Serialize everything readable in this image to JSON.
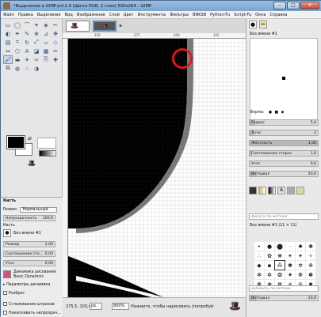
{
  "window": {
    "title": "*Выделение в GIMP.xcf-1.0 (Цвета RGB, 2 слоя) 500x284 – GIMP",
    "controls": {
      "minimize": "–",
      "maximize": "□",
      "close": "✕"
    }
  },
  "menubar": {
    "items": [
      "Файл",
      "Правка",
      "Выделение",
      "Вид",
      "Изображение",
      "Слой",
      "Цвет",
      "Инструменты",
      "Фильтры",
      "BNKSB",
      "Python-Fu",
      "Script-Fu",
      "Окна",
      "Справка"
    ]
  },
  "toolbox": {
    "tools": [
      {
        "icon": "rect-select-icon",
        "glyph": "▭"
      },
      {
        "icon": "ellipse-select-icon",
        "glyph": "◯"
      },
      {
        "icon": "free-select-icon",
        "glyph": "⌒"
      },
      {
        "icon": "fuzzy-select-icon",
        "glyph": "✦"
      },
      {
        "icon": "color-select-icon",
        "glyph": "◈"
      },
      {
        "icon": "scissors-icon",
        "glyph": "✂"
      },
      {
        "icon": "foreground-select-icon",
        "glyph": "◐"
      },
      {
        "icon": "paths-icon",
        "glyph": "✒"
      },
      {
        "icon": "color-picker-icon",
        "glyph": "✎"
      },
      {
        "icon": "zoom-icon",
        "glyph": "⊕"
      },
      {
        "icon": "measure-icon",
        "glyph": "⊿"
      },
      {
        "icon": "move-icon",
        "glyph": "✥"
      },
      {
        "icon": "align-icon",
        "glyph": "▤"
      },
      {
        "icon": "crop-icon",
        "glyph": "⌗"
      },
      {
        "icon": "rotate-icon",
        "glyph": "↻"
      },
      {
        "icon": "scale-icon",
        "glyph": "⤢"
      },
      {
        "icon": "shear-icon",
        "glyph": "▱"
      },
      {
        "icon": "perspective-icon",
        "glyph": "◇"
      },
      {
        "icon": "flip-icon",
        "glyph": "⇔"
      },
      {
        "icon": "cage-icon",
        "glyph": "⬡"
      },
      {
        "icon": "text-icon",
        "glyph": "A"
      },
      {
        "icon": "bucket-fill-icon",
        "glyph": "◪"
      },
      {
        "icon": "blend-icon",
        "glyph": "▦"
      },
      {
        "icon": "pencil-icon",
        "glyph": "✏"
      },
      {
        "icon": "paintbrush-icon",
        "glyph": "🖌"
      },
      {
        "icon": "eraser-icon",
        "glyph": "▬"
      },
      {
        "icon": "airbrush-icon",
        "glyph": "✈"
      },
      {
        "icon": "ink-icon",
        "glyph": "✑"
      },
      {
        "icon": "clone-icon",
        "glyph": "⎘"
      },
      {
        "icon": "heal-icon",
        "glyph": "✚"
      },
      {
        "icon": "perspective-clone-icon",
        "glyph": "⧉"
      },
      {
        "icon": "blur-icon",
        "glyph": "◍"
      },
      {
        "icon": "smudge-icon",
        "glyph": "☝"
      },
      {
        "icon": "dodge-burn-icon",
        "glyph": "◑"
      }
    ],
    "active_tool": 24
  },
  "tool_options": {
    "title": "Кисть",
    "mode_label": "Режим",
    "mode_value": "Нормальный",
    "opacity_label": "Непрозрачность",
    "opacity_value": "100,0",
    "brush_label": "Кисть",
    "brush_value": "Без имени #1",
    "size_label": "Размер",
    "size_value": "2,00",
    "aspect_label": "Соотношение сто...",
    "aspect_value": "0,00",
    "angle_label": "Угол",
    "angle_value": "0,00",
    "dynamics_label": "Динамика рисования",
    "dynamics_value": "Basic Dynamics",
    "dyn_params": "Параметры динамики",
    "scatter": "Разброс",
    "smooth": "Сглаживание штрихов",
    "accumulate": "Накапливать непрозрач..."
  },
  "canvas": {
    "ruler_marks": [
      "250",
      "275",
      "300",
      "325"
    ],
    "thumb_labels": [
      "",
      ""
    ]
  },
  "statusbar": {
    "coords": "275,5, 103,4",
    "unit": "px",
    "zoom": "800%",
    "message": "Нажмите, чтобы нарисовать (попробуй"
  },
  "dock": {
    "brush_name": "Без имени #1",
    "shape_label": "Форма:",
    "radius_label": "Радиус",
    "radius_value": "5,0",
    "spikes_label": "Лучи",
    "spikes_value": "2",
    "hardness_label": "Жёсткость",
    "hardness_value": "1,00",
    "aspect_label": "Соотношение сторон",
    "aspect_value": "1,0",
    "angle_label": "Угол",
    "angle_value": "0,0",
    "spacing_label": "Интервал",
    "spacing_value": "20,0",
    "filter_label": "фильтр по меткам",
    "brushes_title": "Без имени #1 (11 × 11)",
    "tags_label": "добавить по меткам",
    "spacing2_label": "Интервал",
    "spacing2_value": "20,0"
  }
}
